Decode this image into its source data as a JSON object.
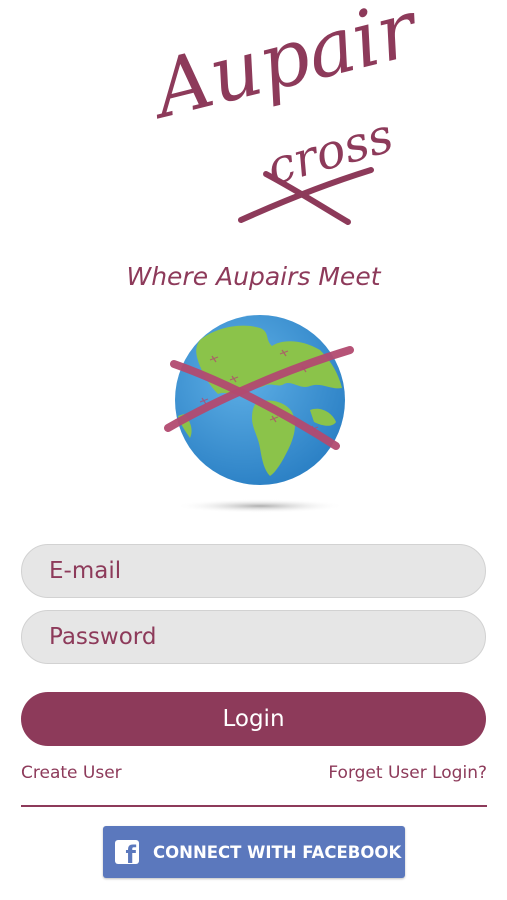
{
  "brand": {
    "logo_word_1": "Aupair",
    "logo_word_2": "cross",
    "tagline": "Where Aupairs Meet",
    "color": "#8d3a5a"
  },
  "form": {
    "email_placeholder": "E-mail",
    "password_placeholder": "Password",
    "login_label": "Login"
  },
  "links": {
    "create_user": "Create User",
    "forgot_login": "Forget User Login?"
  },
  "facebook": {
    "label": "CONNECT WITH FACEBOOK",
    "icon": "facebook-f-icon",
    "color": "#5b78bd"
  },
  "globe": {
    "icon": "globe-with-cross-icon"
  }
}
